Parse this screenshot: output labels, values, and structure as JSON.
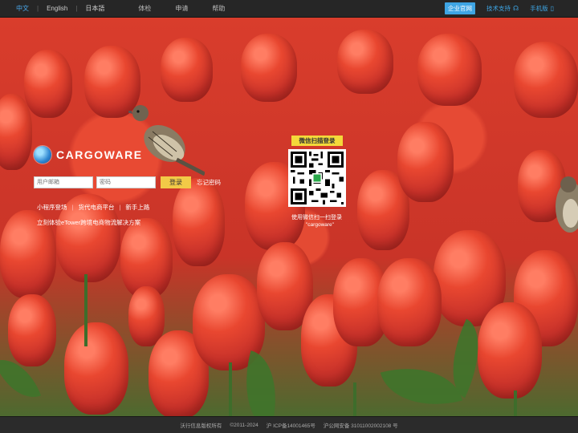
{
  "top": {
    "languages": [
      "中文",
      "English",
      "日本語"
    ],
    "nav": [
      "体检",
      "申请",
      "帮助"
    ],
    "enterprise_badge": "企业官网",
    "support": "技术支持",
    "mobile": "手机版"
  },
  "brand": {
    "name": "CARGOWARE"
  },
  "login": {
    "email_placeholder": "用户邮箱",
    "password_placeholder": "密码",
    "submit": "登录",
    "forgot": "忘记密码"
  },
  "links": [
    "小程序登场",
    "货代电商平台",
    "新手上路"
  ],
  "promo": "立刻体验eTower跨境电商物流解决方案",
  "qr": {
    "title": "微信扫描登录",
    "note1": "使用微信扫一扫登录",
    "note2": "\"cargoware\""
  },
  "footer": {
    "company": "沃行信息版权所有",
    "years": "©2011-2024",
    "icp": "沪 ICP备14001465号",
    "police": "沪公网安备 31011002002108 号"
  },
  "colors": {
    "accent": "#3ea5e4",
    "login_button": "#f2ca47",
    "qr_title": "#f4d93a"
  }
}
